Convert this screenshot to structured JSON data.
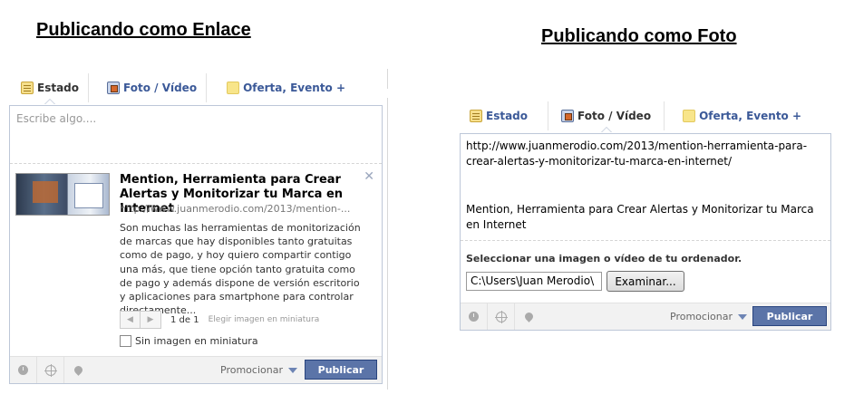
{
  "left": {
    "heading": "Publicando como Enlace",
    "tabs": [
      {
        "label": "Estado",
        "active": true,
        "icon": "status-icon"
      },
      {
        "label": "Foto / Vídeo",
        "active": false,
        "icon": "photo-icon"
      },
      {
        "label": "Oferta, Evento +",
        "active": false,
        "icon": "offer-icon"
      }
    ],
    "placeholder": "Escribe algo....",
    "link": {
      "title": "Mention, Herramienta para Crear Alertas y Monitorizar tu Marca en Internet",
      "url": "http://www.juanmerodio.com/2013/mention-...",
      "description": "Son muchas las herramientas de monitorización de marcas que hay disponibles tanto gratuitas como de pago, y hoy quiero compartir contigo una más, que tiene opción tanto gratuita como de pago y además dispone de versión escritorio y aplicaciones para smartphone para controlar directamente...",
      "close_glyph": "✕"
    },
    "pager": {
      "prev_glyph": "◀",
      "next_glyph": "▶",
      "count": "1 de 1",
      "choose_thumb": "Elegir imagen en miniatura"
    },
    "no_thumb_label": "Sin imagen en miniatura",
    "footer": {
      "promote": "Promocionar",
      "publish": "Publicar"
    }
  },
  "right": {
    "heading": "Publicando como Foto",
    "tabs": [
      {
        "label": "Estado",
        "active": false,
        "icon": "status-icon"
      },
      {
        "label": "Foto / Vídeo",
        "active": true,
        "icon": "photo-icon"
      },
      {
        "label": "Oferta, Evento +",
        "active": false,
        "icon": "offer-icon"
      }
    ],
    "url_text": "http://www.juanmerodio.com/2013/mention-herramienta-para-crear-alertas-y-monitorizar-tu-marca-en-internet/",
    "title_text": "Mention, Herramienta para Crear Alertas y Monitorizar tu Marca en Internet",
    "select_label": "Seleccionar una imagen o vídeo de tu ordenador.",
    "file_path": "C:\\Users\\Juan Merodio\\",
    "browse_button": "Examinar...",
    "footer": {
      "promote": "Promocionar",
      "publish": "Publicar"
    }
  },
  "colors": {
    "facebook_blue": "#3b5998",
    "publish_button": "#5b74a8",
    "border": "#bdc7d8"
  }
}
